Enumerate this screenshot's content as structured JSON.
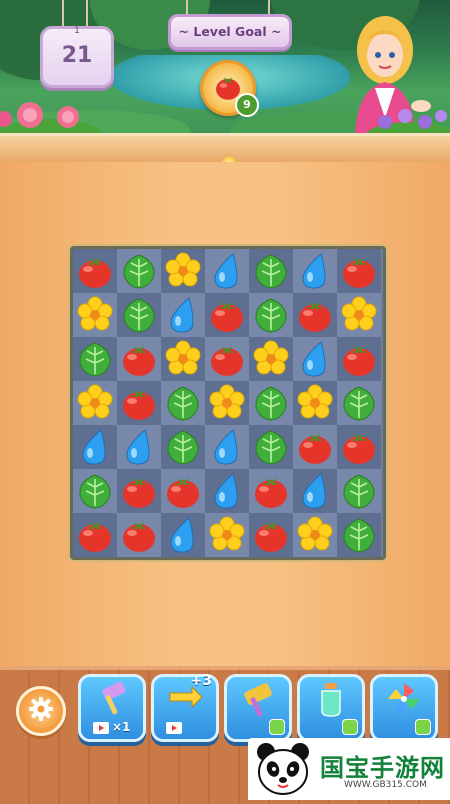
{
  "hud": {
    "moves_label": "1",
    "moves_value": "21",
    "goal_title": "~ Level Goal ~",
    "goal_item": "tomato",
    "goal_count": "9"
  },
  "board": {
    "rows": [
      [
        "tomato",
        "leaf",
        "flower",
        "drop",
        "leaf",
        "drop",
        "tomato"
      ],
      [
        "flower",
        "leaf",
        "drop",
        "tomato",
        "leaf",
        "tomato",
        "flower"
      ],
      [
        "leaf",
        "tomato",
        "flower",
        "tomato",
        "flower",
        "drop",
        "tomato"
      ],
      [
        "flower",
        "tomato",
        "leaf",
        "flower",
        "leaf",
        "flower",
        "leaf"
      ],
      [
        "drop",
        "drop",
        "leaf",
        "drop",
        "leaf",
        "tomato",
        "tomato"
      ],
      [
        "leaf",
        "tomato",
        "tomato",
        "drop",
        "tomato",
        "drop",
        "leaf"
      ],
      [
        "tomato",
        "tomato",
        "drop",
        "flower",
        "tomato",
        "flower",
        "leaf"
      ]
    ]
  },
  "toolbar": {
    "settings_icon": "gear-icon",
    "boosters": [
      {
        "name": "hammer-booster",
        "count": "×1",
        "extra": ""
      },
      {
        "name": "swap-booster",
        "count": "",
        "extra": "+3"
      },
      {
        "name": "mallet-booster",
        "count": "",
        "extra": ""
      },
      {
        "name": "potion-booster",
        "count": "",
        "extra": ""
      },
      {
        "name": "pinwheel-booster",
        "count": "",
        "extra": ""
      }
    ]
  },
  "watermark": {
    "text": "国宝手游网",
    "url": "WWW.GB315.COM"
  },
  "colors": {
    "tomato": "#e5352b",
    "leaf": "#3fae3a",
    "flower": "#ffcf1e",
    "drop": "#2d9ff0",
    "board_dark": "#5f6f91",
    "board_light": "#7788aa"
  }
}
